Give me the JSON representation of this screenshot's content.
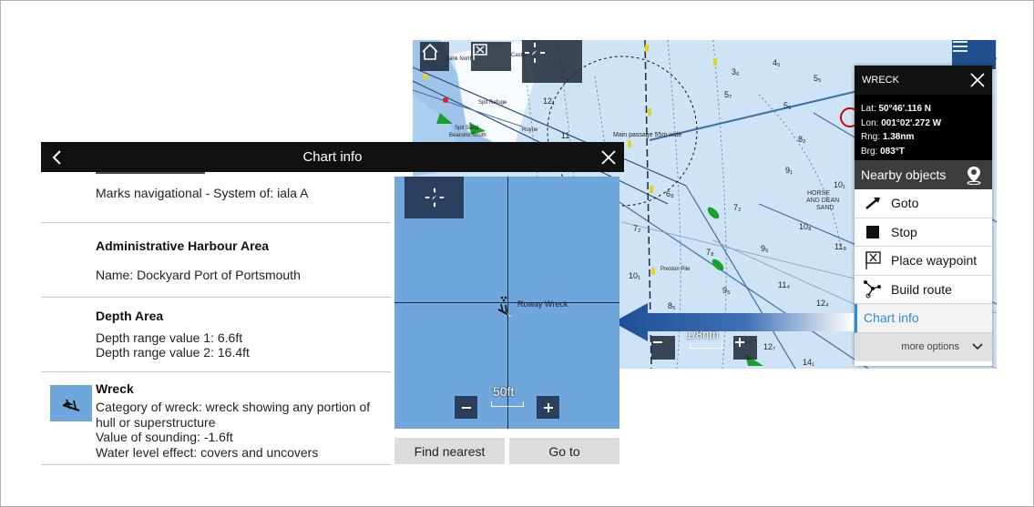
{
  "background_chart": {
    "scale_label": "1/8nm",
    "labels": [
      "Spit Refuge",
      "Spit Sand Beacons South",
      "Main passage 55m wide",
      "Preston Pile",
      "HORSE AND DEAN SAND",
      "Castle",
      "Bank North"
    ],
    "soundings": [
      "10₈",
      "4₅",
      "5₅",
      "5₅",
      "8₂",
      "9₁",
      "10₁",
      "10₈",
      "11₈",
      "9₅",
      "11₄",
      "12₄",
      "14₁",
      "12₇",
      "8₅",
      "10₁",
      "7₂",
      "6₈",
      "7₂",
      "7₈",
      "9₅",
      "3₆",
      "5₇",
      "12₁",
      "11",
      "11"
    ]
  },
  "context_menu": {
    "title": "WRECK",
    "lat_label": "Lat:",
    "lat": "50°46'.116 N",
    "lon_label": "Lon:",
    "lon": "001°02'.272 W",
    "rng_label": "Rng:",
    "rng": "1.38nm",
    "brg_label": "Brg:",
    "brg": "083°T",
    "nearby": "Nearby objects",
    "items": [
      {
        "label": "Goto",
        "icon": "goto-icon"
      },
      {
        "label": "Stop",
        "icon": "stop-icon"
      },
      {
        "label": "Place waypoint",
        "icon": "waypoint-icon"
      },
      {
        "label": "Build route",
        "icon": "route-icon"
      }
    ],
    "active_item": "Chart info",
    "more": "more options"
  },
  "chart_info": {
    "title": "Chart info",
    "sections": [
      {
        "title": "",
        "lines": [
          "Marks navigational - System of: iala A"
        ]
      },
      {
        "title": "Administrative Harbour Area",
        "lines": [
          "Name: Dockyard Port of Portsmouth"
        ]
      },
      {
        "title": "Depth Area",
        "lines": [
          "Depth range value 1: 6.6ft",
          "Depth range value 2: 16.4ft"
        ]
      },
      {
        "title": "Wreck",
        "lines": [
          "Category of wreck: wreck showing any portion of hull or superstructure",
          "Value of sounding: -1.6ft",
          "Water level effect: covers and uncovers"
        ]
      }
    ],
    "map_label": "Roway Wreck",
    "map_scale": "50ft",
    "find_nearest": "Find nearest",
    "go_to": "Go to"
  },
  "colors": {
    "accent": "#2b8fd6",
    "bar": "#111111",
    "water_light": "#cfe3f6",
    "water_detail": "#6fa6dc"
  }
}
